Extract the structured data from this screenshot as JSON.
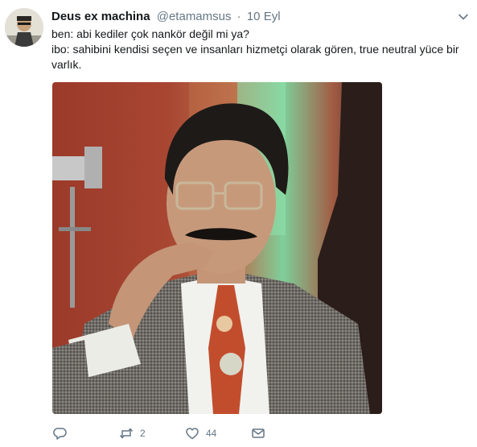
{
  "tweet": {
    "author_name": "Deus ex machina",
    "handle": "@etamamsus",
    "separator": "·",
    "time": "10 Eyl",
    "lines": [
      "ben: abi kediler çok nankör değil mi ya?",
      "ibo: sahibini kendisi seçen ve insanları hizmetçi olarak gören, true neutral yüce bir",
      "varlık."
    ],
    "retweet_count": "2",
    "like_count": "44"
  },
  "icons": [
    "chevron-down-icon",
    "reply-icon",
    "retweet-icon",
    "like-icon",
    "direct-message-icon"
  ],
  "colors": {
    "text": "#14171a",
    "secondary": "#657786",
    "background": "#ffffff"
  }
}
